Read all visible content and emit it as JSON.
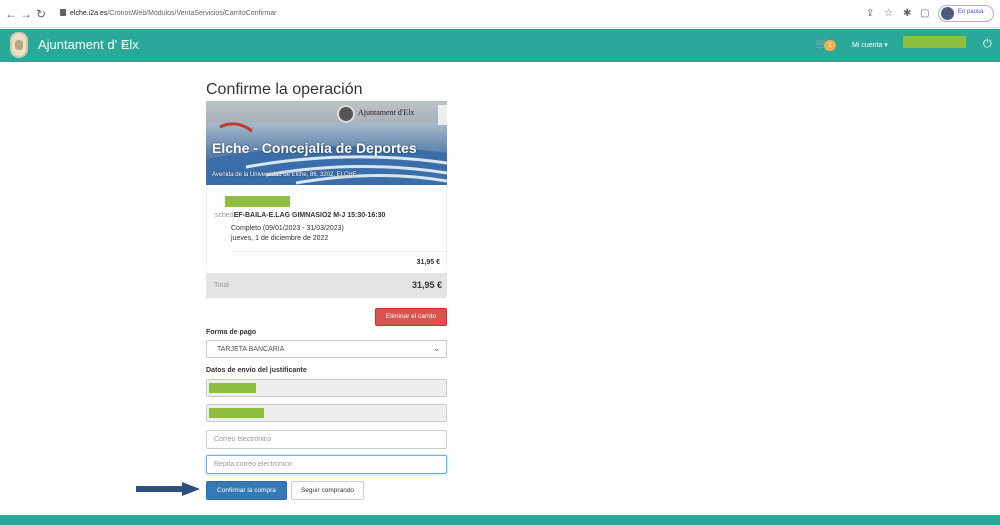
{
  "browser": {
    "url_host": "elche.i2a.es",
    "url_path": "/CronosWeb/Modulos/VentaServicios/CarritoConfirmar",
    "profile_status": "En pausa"
  },
  "header": {
    "brand": "Ajuntament d' Elx",
    "cart_count": "1",
    "account_label": "Mi cuenta ▾",
    "colors": {
      "bar": "#2aa89a",
      "badge": "#f0ad4e",
      "redaction": "#8fbf3f"
    }
  },
  "main": {
    "title": "Confirme la operación",
    "banner": {
      "logo_text": "Ajuntament d'Elx",
      "heading": "Elche - Concejalía de Deportes",
      "address": "Avenida de la Universidad de Elche, 86, 3202, ELCHE"
    },
    "item": {
      "prefix": "sched",
      "title": "EF-BAILA-E.LAG GIMNASIO2 M-J 15:30-16:30",
      "period": "Completo (09/01/2023 - 31/03/2023)",
      "date": "jueves, 1 de diciembre de 2022",
      "price": "31,95 €"
    },
    "total": {
      "label": "Total",
      "value": "31,95 €"
    },
    "empty_cart_label": "Eliminar el carrito",
    "payment": {
      "label": "Forma de pago",
      "selected": "TARJETA BANCARIA"
    },
    "receipt": {
      "label": "Datos de envío del justificante",
      "email_placeholder": "Correo electrónico",
      "repeat_email_placeholder": "Repita correo electrónico"
    },
    "confirm_label": "Confirmar la compra",
    "continue_label": "Seguir comprando",
    "colors": {
      "primary": "#337ab7",
      "danger": "#d9534f",
      "arrow": "#2f4f7f"
    }
  }
}
